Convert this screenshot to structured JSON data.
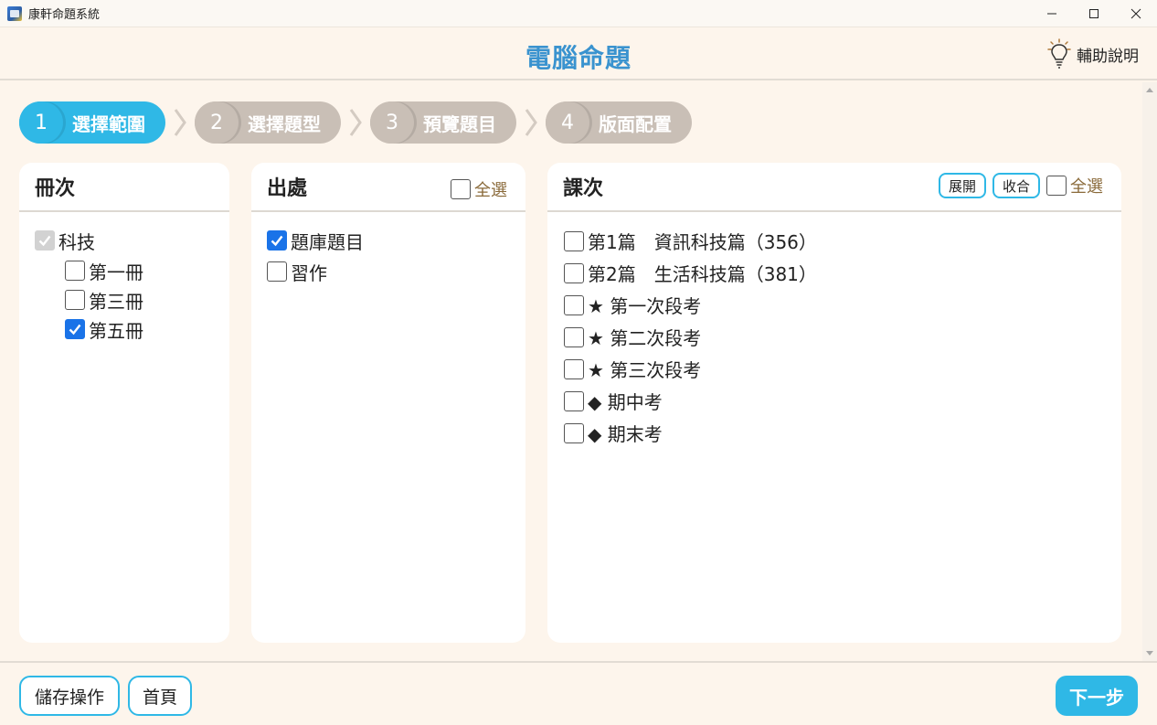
{
  "window": {
    "title": "康軒命題系統",
    "minimize": "—",
    "maximize": "☐",
    "close": "✕"
  },
  "header": {
    "title": "電腦命題",
    "help_label": "輔助說明"
  },
  "steps": [
    {
      "num": "1",
      "label": "選擇範圍",
      "active": true
    },
    {
      "num": "2",
      "label": "選擇題型",
      "active": false
    },
    {
      "num": "3",
      "label": "預覽題目",
      "active": false
    },
    {
      "num": "4",
      "label": "版面配置",
      "active": false
    }
  ],
  "panels": {
    "volumes": {
      "title": "冊次",
      "root": {
        "label": "科技",
        "checked": true,
        "disabled": true
      },
      "items": [
        {
          "label": "第一冊",
          "checked": false
        },
        {
          "label": "第三冊",
          "checked": false
        },
        {
          "label": "第五冊",
          "checked": true
        }
      ]
    },
    "sources": {
      "title": "出處",
      "select_all": "全選",
      "items": [
        {
          "label": "題庫題目",
          "checked": true
        },
        {
          "label": "習作",
          "checked": false
        }
      ]
    },
    "lessons": {
      "title": "課次",
      "expand_label": "展開",
      "collapse_label": "收合",
      "select_all": "全選",
      "items": [
        {
          "label": "第1篇　資訊科技篇（356）",
          "checked": false
        },
        {
          "label": "第2篇　生活科技篇（381）",
          "checked": false
        },
        {
          "label": "★ 第一次段考",
          "checked": false
        },
        {
          "label": "★ 第二次段考",
          "checked": false
        },
        {
          "label": "★ 第三次段考",
          "checked": false
        },
        {
          "label": "◆ 期中考",
          "checked": false
        },
        {
          "label": "◆ 期末考",
          "checked": false
        }
      ]
    }
  },
  "footer": {
    "save_label": "儲存操作",
    "home_label": "首頁",
    "next_label": "下一步"
  },
  "colors": {
    "accent": "#2fb8e6",
    "title": "#3a93cf",
    "step_inactive": "#c9bfb6",
    "background": "#fdf5ec",
    "checkbox_checked": "#1a73e8"
  }
}
